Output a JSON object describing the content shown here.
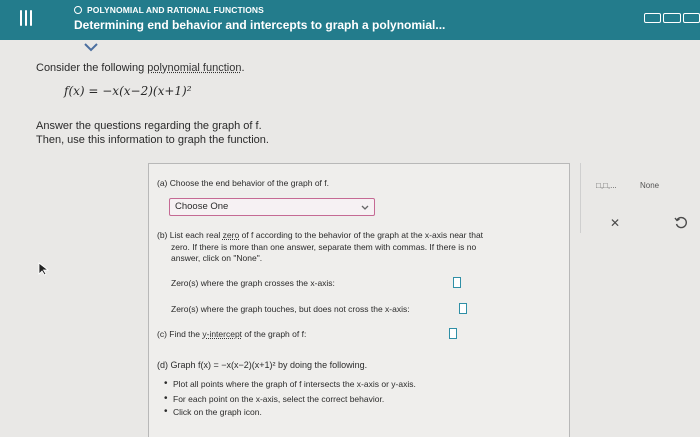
{
  "header": {
    "topic": "POLYNOMIAL AND RATIONAL FUNCTIONS",
    "title": "Determining end behavior and intercepts to graph a polynomial..."
  },
  "question": {
    "intro_prefix": "Consider the following ",
    "intro_link": "polynomial function",
    "intro_suffix": ".",
    "formula": "f(x) = −x(x−2)(x+1)²",
    "instruction_line1": "Answer the questions regarding the graph of f.",
    "instruction_line2": "Then, use this information to graph the function."
  },
  "panel": {
    "part_a": "(a) Choose the end behavior of the graph of f.",
    "dropdown_value": "Choose One",
    "part_b_prefix": "(b) List each real ",
    "part_b_link": "zero",
    "part_b_suffix": " of f according to the behavior of the graph at the x-axis near that",
    "part_b_line2": "zero. If there is more than one answer, separate them with commas. If there is no",
    "part_b_line3": "answer, click on \"None\".",
    "zeros_cross_label": "Zero(s) where the graph crosses the x-axis:",
    "zeros_touch_label": "Zero(s) where the graph touches, but does not cross the x-axis:",
    "part_c_prefix": "(c) Find the ",
    "part_c_link": "y-intercept",
    "part_c_suffix": " of the graph of f:",
    "part_d": "(d) Graph f(x) = −x(x−2)(x+1)² by doing the following.",
    "bullets": [
      "Plot all points where the graph of f intersects the x-axis or y-axis.",
      "For each point on the x-axis, select the correct behavior.",
      "Click on the graph icon."
    ]
  },
  "tools": {
    "list_label": "□,□,...",
    "none_label": "None"
  },
  "icons": {
    "menu": "menu-icon",
    "clear": "x-icon",
    "undo": "undo-icon",
    "expand": "chevron-down-icon"
  },
  "colors": {
    "header_bg": "#237c8c",
    "dropdown_border": "#c56a94",
    "answer_box_border": "#2f8fa6"
  }
}
